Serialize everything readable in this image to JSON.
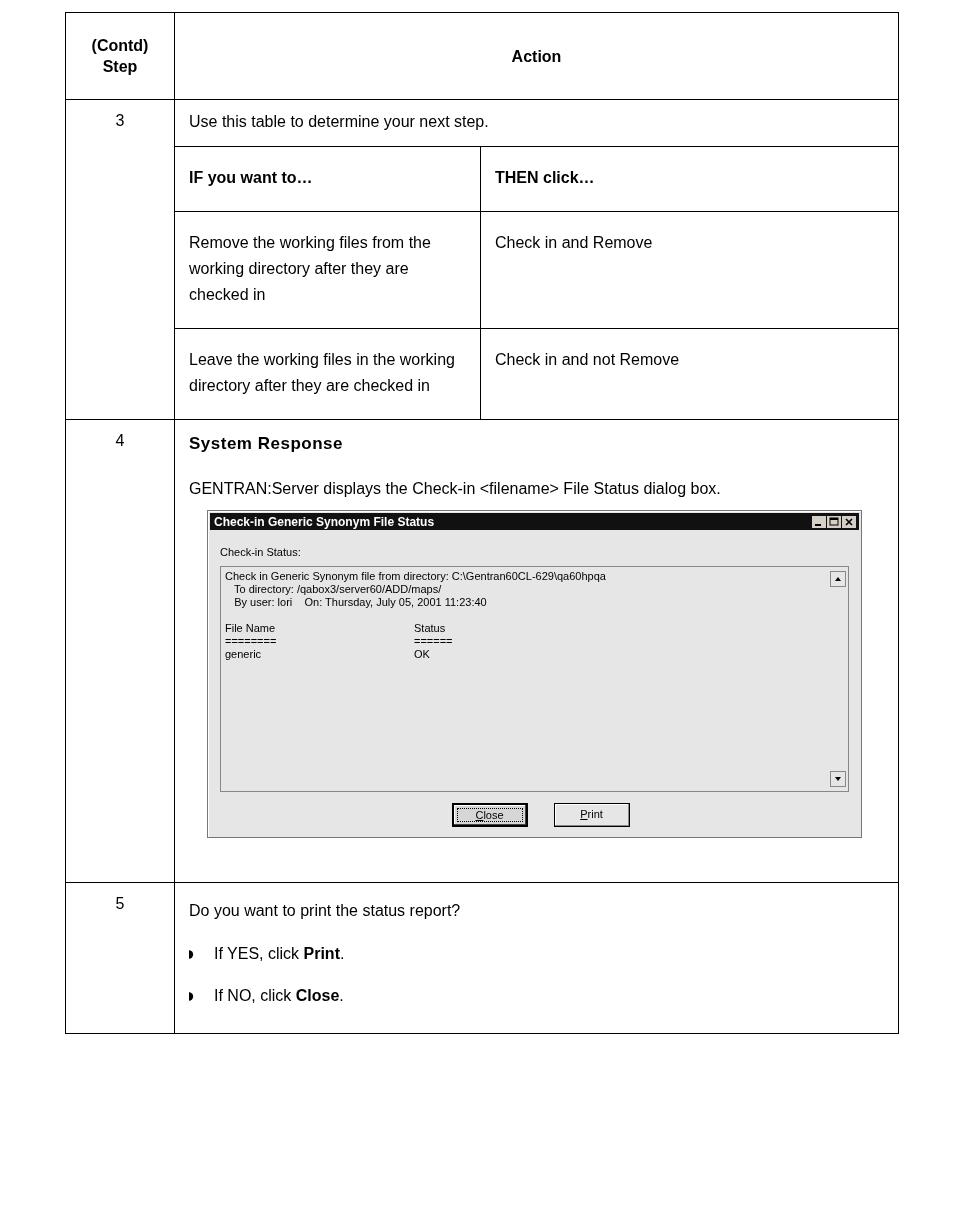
{
  "table": {
    "columns": [
      "(Contd) Step",
      "Action"
    ],
    "rows": [
      {
        "kind": "decision",
        "step": "3",
        "text": "Use this table to determine your next step.",
        "decision": {
          "columns": [
            "IF you want to…",
            "THEN click…"
          ],
          "rows": [
            {
              "condition": "Remove the working files from the working directory after they are checked in",
              "action": "Check in and Remove"
            },
            {
              "condition": "Leave the working files in the working directory after they are checked in",
              "action": "Check in and not Remove"
            }
          ]
        }
      },
      {
        "kind": "response",
        "step": "4",
        "heading": "System Response",
        "text": "GENTRAN:Server displays the Check-in <filename> File Status dialog box.",
        "dialog": {
          "title": "Check-in Generic Synonym File Status",
          "label": "Check-in Status:",
          "lines": [
            "Check in Generic Synonym file from directory: C:\\Gentran60CL-629\\qa60hpqa",
            "   To directory: /qabox3/server60/ADD/maps/",
            "   By user: lori    On: Thursday, July 05, 2001 11:23:40"
          ],
          "status_columns": [
            {
              "heading": "File Name",
              "rule": "========",
              "values": [
                "generic"
              ]
            },
            {
              "heading": "Status",
              "rule": "======",
              "values": [
                "OK"
              ]
            }
          ],
          "buttons": [
            {
              "label": "Close",
              "selected": true
            },
            {
              "label": "Print",
              "selected": false
            }
          ]
        }
      },
      {
        "kind": "question",
        "step": "5",
        "text": "Do you want to print the status report?",
        "bullets": [
          "If YES, click **Print**.",
          "If NO, click **Close**."
        ]
      }
    ]
  }
}
